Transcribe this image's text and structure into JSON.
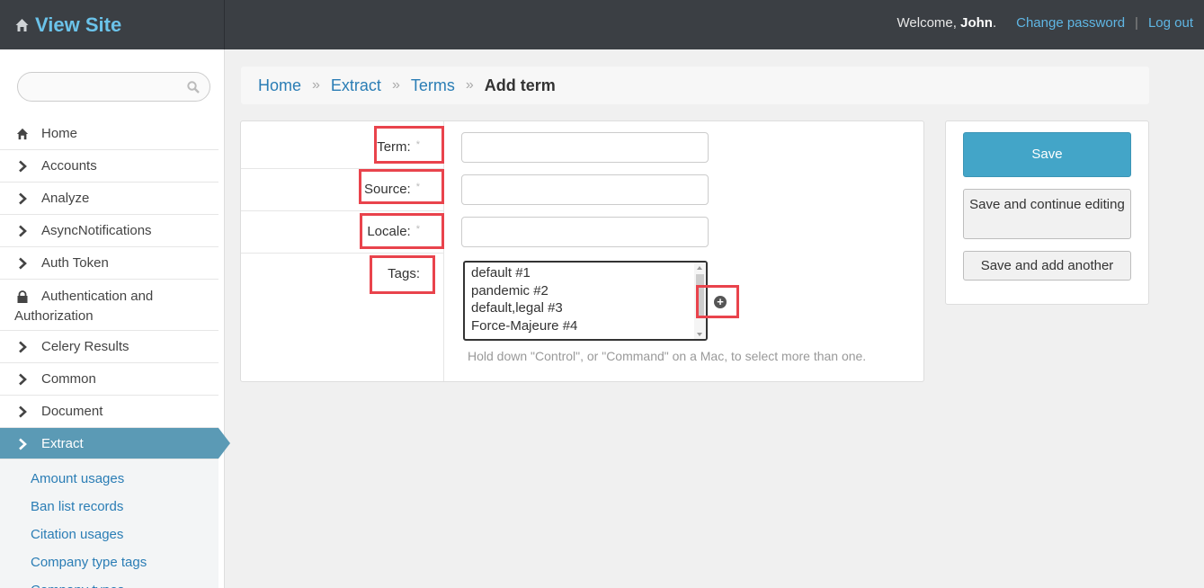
{
  "header": {
    "site_title": "View Site",
    "welcome_prefix": "Welcome,",
    "user_name": "John",
    "welcome_suffix": ".",
    "change_password": "Change password",
    "separator": "|",
    "logout": "Log out"
  },
  "sidebar": {
    "search_value": "",
    "items": [
      {
        "label": "Home",
        "icon": "home-icon"
      },
      {
        "label": "Accounts",
        "icon": "chevron-right-icon"
      },
      {
        "label": "Analyze",
        "icon": "chevron-right-icon"
      },
      {
        "label": "AsyncNotifications",
        "icon": "chevron-right-icon"
      },
      {
        "label": "Auth Token",
        "icon": "chevron-right-icon"
      },
      {
        "label": "Authentication and Authorization",
        "icon": "lock-icon"
      },
      {
        "label": "Celery Results",
        "icon": "chevron-right-icon"
      },
      {
        "label": "Common",
        "icon": "chevron-right-icon"
      },
      {
        "label": "Document",
        "icon": "chevron-right-icon"
      },
      {
        "label": "Extract",
        "icon": "chevron-right-icon",
        "active": true
      }
    ],
    "subitems": [
      "Amount usages",
      "Ban list records",
      "Citation usages",
      "Company type tags",
      "Company types"
    ]
  },
  "breadcrumbs": {
    "items": [
      "Home",
      "Extract",
      "Terms"
    ],
    "separator": "»",
    "current": "Add term"
  },
  "form": {
    "fields": [
      {
        "label": "Term:",
        "required": "*",
        "value": ""
      },
      {
        "label": "Source:",
        "required": "*",
        "value": ""
      },
      {
        "label": "Locale:",
        "required": "*",
        "value": ""
      }
    ],
    "tags": {
      "label": "Tags:",
      "options": [
        "default #1",
        "pandemic #2",
        "default,legal #3",
        "Force-Majeure #4"
      ],
      "add_icon": "plus-circle-icon",
      "help": "Hold down \"Control\", or \"Command\" on a Mac, to select more than one."
    }
  },
  "actions": {
    "save": "Save",
    "save_continue": "Save and continue editing",
    "save_another": "Save and add another"
  },
  "colors": {
    "topbar": "#3b3f44",
    "brand": "#6bc3ea",
    "link": "#2a7db5",
    "active_nav": "#5b9ab5",
    "highlight": "#e9434c",
    "primary_button": "#43a5c8"
  }
}
